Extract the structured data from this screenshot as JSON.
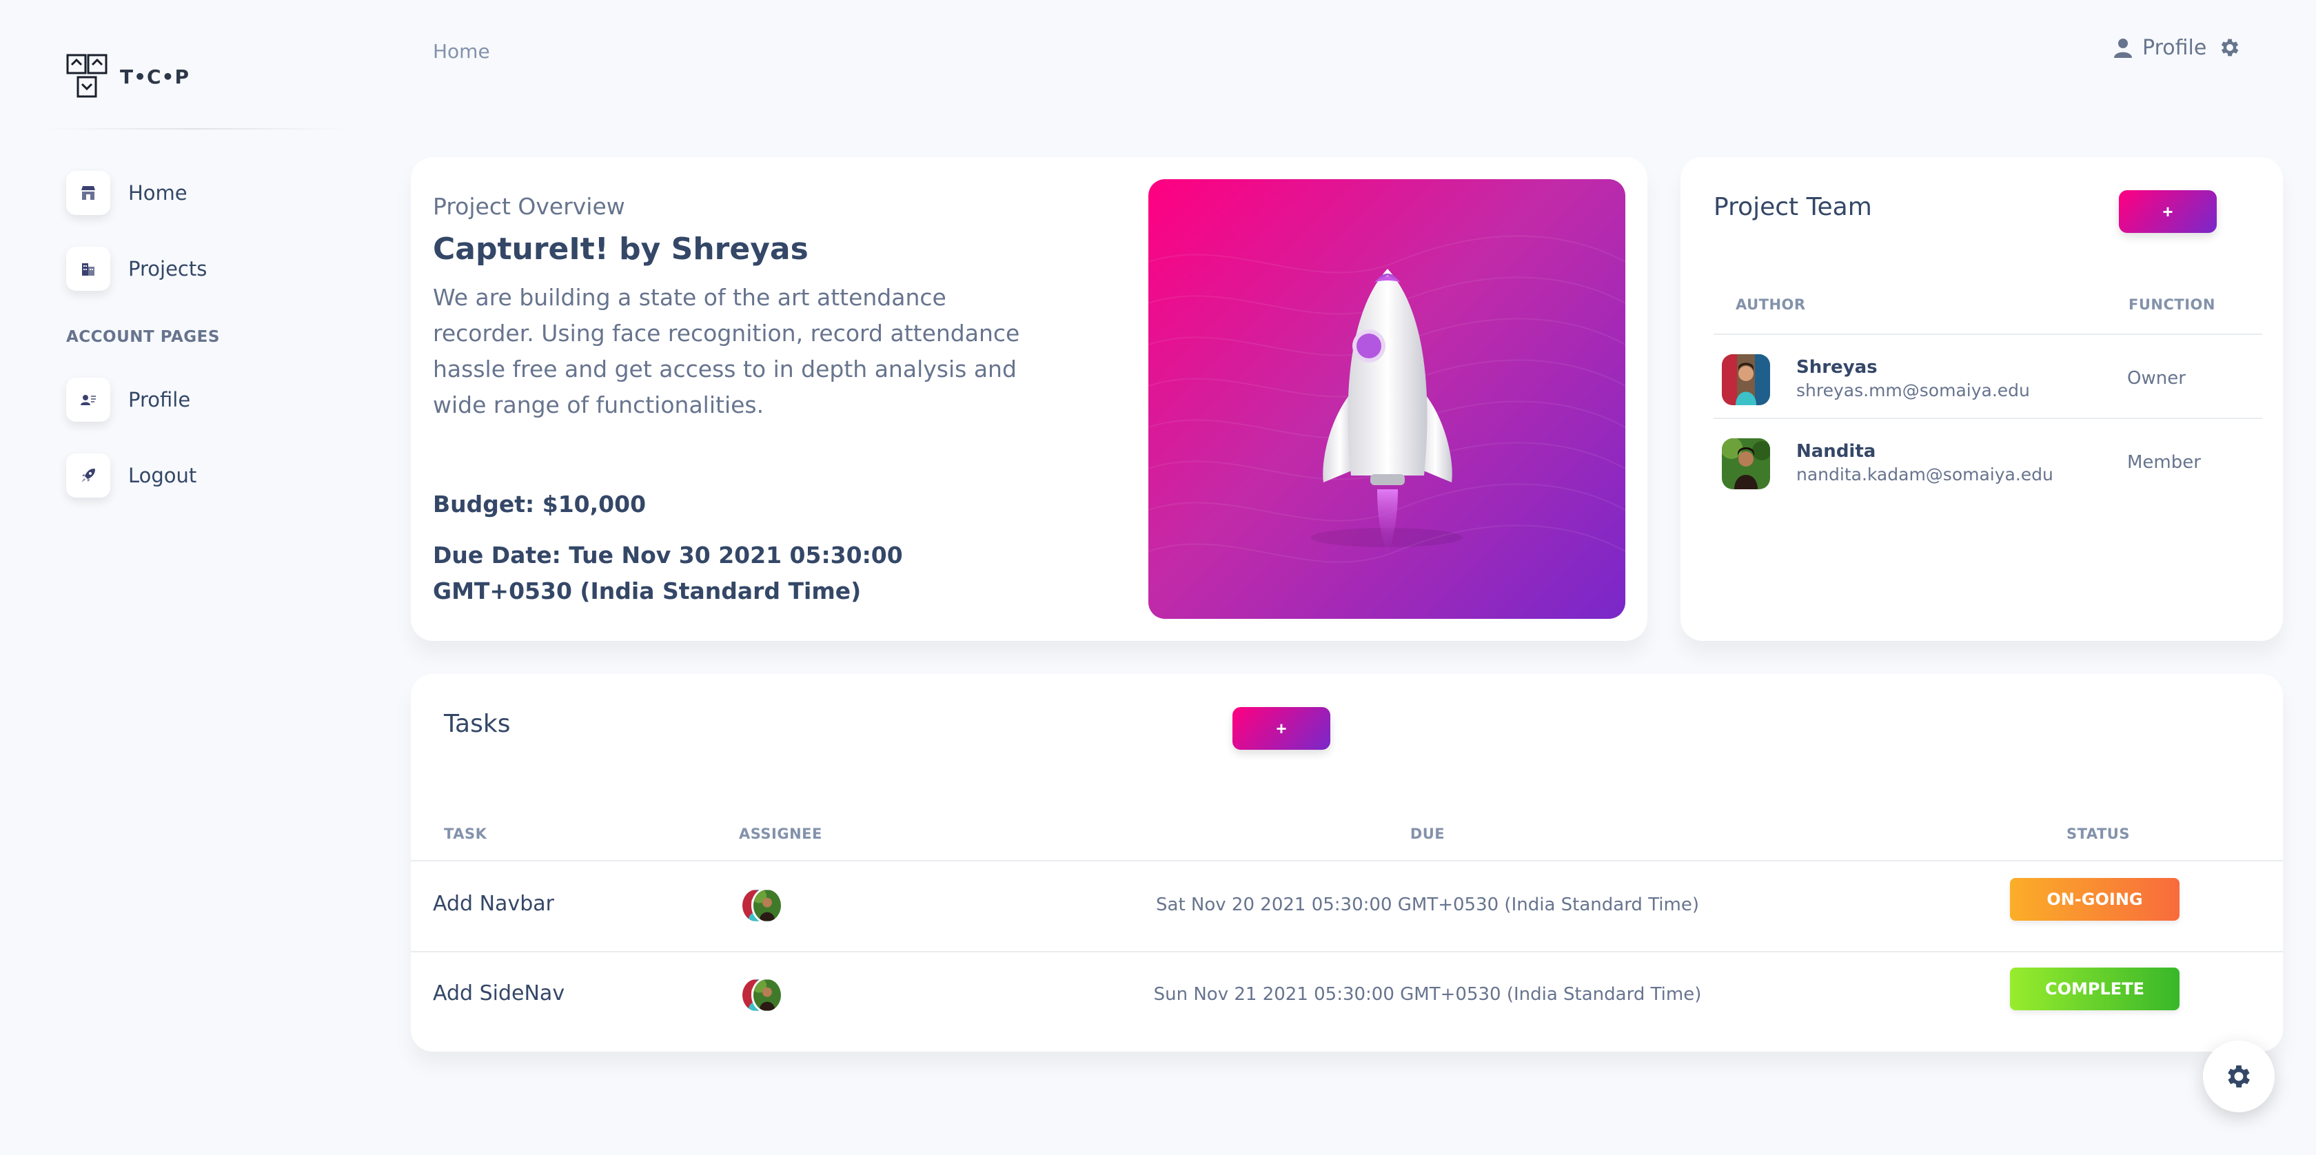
{
  "app": {
    "logo_text": "T•C•P"
  },
  "sidebar": {
    "items": [
      {
        "label": "Home",
        "icon": "shop-icon"
      },
      {
        "label": "Projects",
        "icon": "office-icon"
      }
    ],
    "section_heading": "ACCOUNT PAGES",
    "account_items": [
      {
        "label": "Profile",
        "icon": "profile-card-icon"
      },
      {
        "label": "Logout",
        "icon": "rocket-icon"
      }
    ]
  },
  "header": {
    "breadcrumb": "Home",
    "profile_label": "Profile"
  },
  "overview": {
    "subtitle": "Project Overview",
    "title": "CaptureIt! by Shreyas",
    "description": "We are building a state of the art attendance recorder. Using face recognition, record attendance hassle free and get access to in depth analysis and wide range of functionalities.",
    "budget": "Budget: $10,000",
    "due_date": "Due Date: Tue Nov 30 2021 05:30:00 GMT+0530 (India Standard Time)"
  },
  "team": {
    "title": "Project Team",
    "add_label": "+",
    "columns": {
      "author": "AUTHOR",
      "function": "FUNCTION"
    },
    "members": [
      {
        "name": "Shreyas",
        "email": "shreyas.mm@somaiya.edu",
        "function": "Owner"
      },
      {
        "name": "Nandita",
        "email": "nandita.kadam@somaiya.edu",
        "function": "Member"
      }
    ]
  },
  "tasks": {
    "title": "Tasks",
    "add_label": "+",
    "columns": {
      "task": "TASK",
      "assignee": "ASSIGNEE",
      "due": "DUE",
      "status": "STATUS"
    },
    "rows": [
      {
        "task": "Add Navbar",
        "due": "Sat Nov 20 2021 05:30:00 GMT+0530 (India Standard Time)",
        "status": "ON-GOING",
        "status_color": "#f97c3c"
      },
      {
        "task": "Add SideNav",
        "due": "Sun Nov 21 2021 05:30:00 GMT+0530 (India Standard Time)",
        "status": "COMPLETE",
        "status_color": "#5fcb26"
      }
    ]
  },
  "colors": {
    "accent_gradient_start": "#ff0080",
    "accent_gradient_end": "#7928ca",
    "ongoing_start": "#fbae28",
    "ongoing_end": "#f86b3c",
    "complete_start": "#98ec2d",
    "complete_end": "#38b72a"
  }
}
